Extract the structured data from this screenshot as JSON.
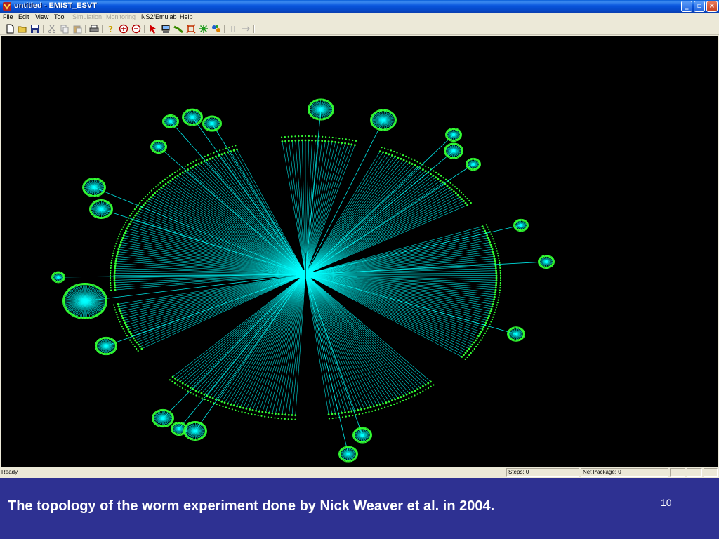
{
  "window": {
    "title": "untitled - EMIST_ESVT",
    "controls": {
      "minimize": "_",
      "restore": "▫",
      "close": "×"
    }
  },
  "menubar": {
    "items": [
      {
        "label": "File",
        "enabled": true
      },
      {
        "label": "Edit",
        "enabled": true
      },
      {
        "label": "View",
        "enabled": true
      },
      {
        "label": "Tool",
        "enabled": true
      },
      {
        "label": "Simulation",
        "enabled": false
      },
      {
        "label": "Monitoring",
        "enabled": false
      },
      {
        "label": "NS2/Emulab",
        "enabled": true
      },
      {
        "label": "Help",
        "enabled": true
      }
    ]
  },
  "toolbar": {
    "icons": [
      "new-file-icon",
      "open-folder-icon",
      "save-icon",
      "cut-icon",
      "copy-icon",
      "paste-icon",
      "print-icon",
      "help-icon",
      "zoom-in-icon",
      "zoom-out-icon",
      "select-arrow-icon",
      "computer-icon",
      "router-icon",
      "link-icon",
      "burst-icon",
      "network-icon",
      "pause-icon",
      "step-icon"
    ]
  },
  "canvas": {
    "background": "#000000",
    "link_color": "#00ffff",
    "node_color": "#33ff33"
  },
  "statusbar": {
    "status": "Ready",
    "steps": "Steps: 0",
    "net_package": "Net Package: 0"
  },
  "slide": {
    "caption": "The topology of the worm experiment done by Nick Weaver et al. in 2004.",
    "number": "10",
    "background": "#2e3192"
  }
}
